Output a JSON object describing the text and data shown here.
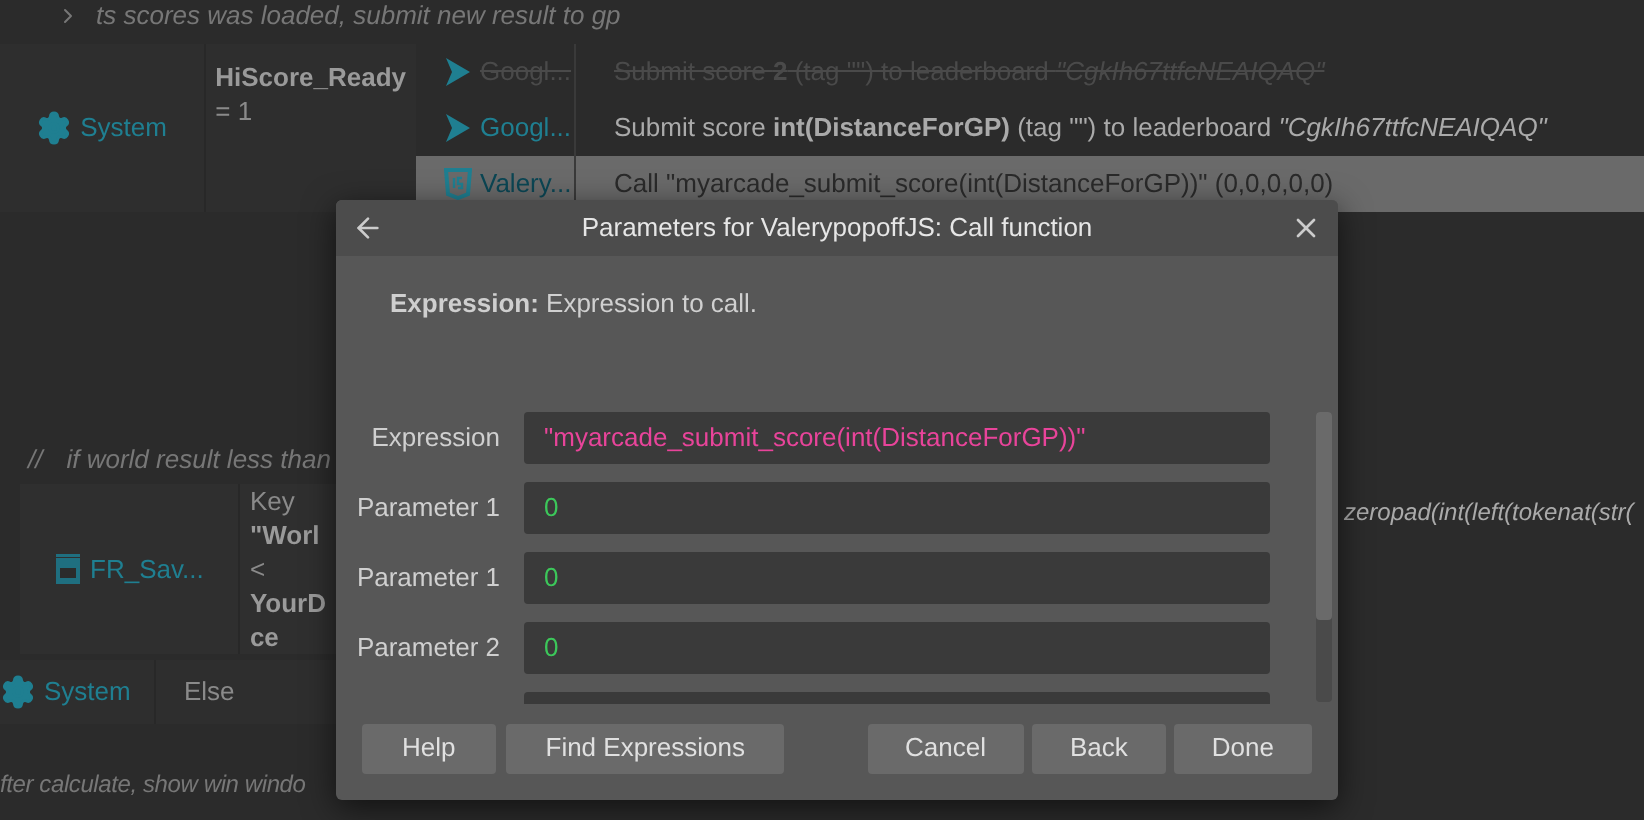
{
  "events": [
    {
      "kind": "comment",
      "text": "ts scores was loaded, submit new result to gp"
    },
    {
      "kind": "event",
      "conditions": [
        {
          "object": "System",
          "kind": "system",
          "lines": [
            {
              "text": "HiScore_Ready",
              "bold": true
            },
            {
              "text": "= 1",
              "bold": false
            }
          ]
        }
      ],
      "actions": [
        {
          "object": "Googl...",
          "kind": "play",
          "disabled": true,
          "selected": false,
          "text": "Submit score **2** (tag \"\") to leaderboard *\"CgkIh67ttfcNEAIQAQ\"*"
        },
        {
          "object": "Googl...",
          "kind": "play",
          "disabled": false,
          "selected": false,
          "text": "Submit score **int(DistanceForGP)** (tag \"\") to leaderboard *\"CgkIh67ttfcNEAIQAQ\"*"
        },
        {
          "object": "Valery...",
          "kind": "js",
          "disabled": false,
          "selected": true,
          "text": "Call \"myarcade_submit_score(int(DistanceForGP))\" (0,0,0,0,0)"
        }
      ]
    },
    {
      "kind": "comment",
      "prefix": "//",
      "text": "if world result less than"
    },
    {
      "kind": "event",
      "conditions": [
        {
          "object": "FR_Sav...",
          "kind": "storage",
          "lines": [
            {
              "text": "Key",
              "bold": false
            },
            {
              "text": "\"Worl",
              "bold": true
            },
            {
              "text": "<",
              "bold": false
            },
            {
              "text": "YourD",
              "bold": true
            },
            {
              "text": "ce",
              "bold": true
            }
          ]
        }
      ],
      "actions": [
        {
          "kind": "plain",
          "disabled": false,
          "selected": false,
          "italic": true,
          "text": "zeropad(int(left(tokenat(str("
        }
      ]
    },
    {
      "kind": "else",
      "conditions": [
        {
          "object": "System",
          "kind": "system",
          "lines": [
            {
              "text": "Else",
              "bold": false
            }
          ]
        }
      ]
    },
    {
      "kind": "comment",
      "text": "fter calculate, show win windo"
    }
  ],
  "dialog": {
    "title": "Parameters for ValerypopoffJS: Call function",
    "description": "**Expression:** Expression to call.",
    "fields": [
      {
        "label": "Expression",
        "value": "\"myarcade_submit_score(int(DistanceForGP))\"",
        "kind": "string"
      },
      {
        "label": "Parameter 1",
        "value": "0",
        "kind": "number"
      },
      {
        "label": "Parameter 1",
        "value": "0",
        "kind": "number"
      },
      {
        "label": "Parameter 2",
        "value": "0",
        "kind": "number"
      },
      {
        "kind": "partial"
      }
    ],
    "buttons_left": [
      "Help",
      "Find Expressions"
    ],
    "buttons_right": [
      "Cancel",
      "Back",
      "Done"
    ]
  }
}
